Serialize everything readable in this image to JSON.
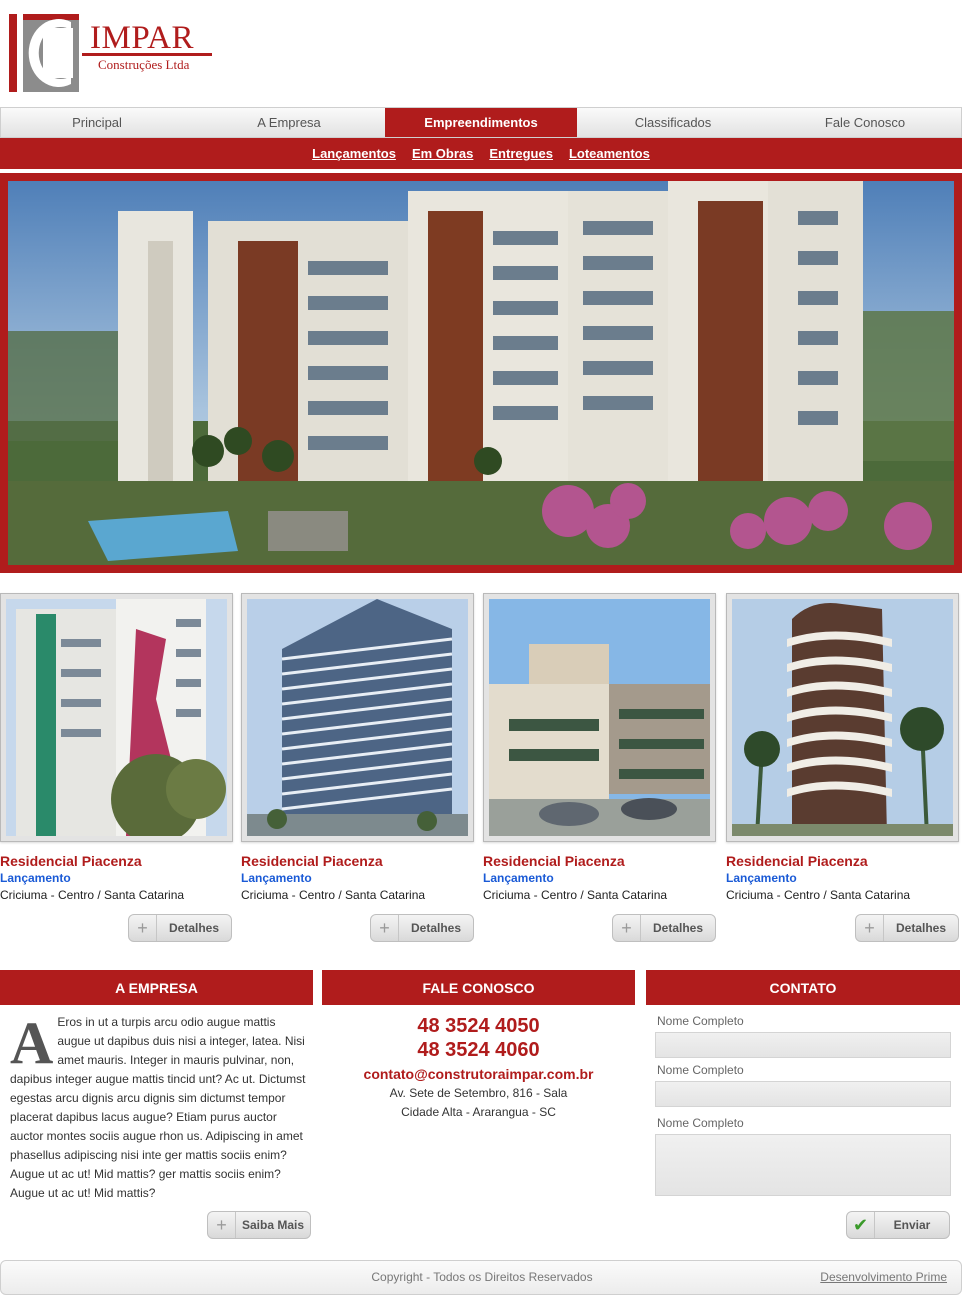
{
  "brand": {
    "name": "IMPAR",
    "subtitle": "Construções Ltda",
    "color": "#b01c1c"
  },
  "nav": {
    "items": [
      {
        "label": "Principal"
      },
      {
        "label": "A Empresa"
      },
      {
        "label": "Empreendimentos",
        "active": true
      },
      {
        "label": "Classificados"
      },
      {
        "label": "Fale Conosco"
      }
    ],
    "subitems": [
      {
        "label": "Lançamentos"
      },
      {
        "label": "Em Obras"
      },
      {
        "label": "Entregues"
      },
      {
        "label": "Loteamentos"
      }
    ]
  },
  "projects": [
    {
      "title": "Residencial Piacenza",
      "status": "Lançamento",
      "location": "Criciuma - Centro / Santa Catarina",
      "button": "Detalhes"
    },
    {
      "title": "Residencial Piacenza",
      "status": "Lançamento",
      "location": "Criciuma - Centro / Santa Catarina",
      "button": "Detalhes"
    },
    {
      "title": "Residencial Piacenza",
      "status": "Lançamento",
      "location": "Criciuma - Centro / Santa Catarina",
      "button": "Detalhes"
    },
    {
      "title": "Residencial Piacenza",
      "status": "Lançamento",
      "location": "Criciuma - Centro / Santa Catarina",
      "button": "Detalhes"
    }
  ],
  "about": {
    "heading": "A EMPRESA",
    "dropcap": "A",
    "text": "Eros in ut a turpis arcu odio augue mattis augue ut dapibus duis nisi a integer, latea. Nisi amet mauris. Integer in mauris pulvinar, non, dapibus integer augue mattis tincid unt? Ac ut. Dictumst egestas arcu dignis arcu dignis sim dictumst tempor placerat dapibus lacus augue? Etiam purus auctor auctor montes sociis augue rhon us. Adipiscing in amet phasellus adipiscing nisi inte ger mattis sociis enim? Augue ut ac ut! Mid mattis? ger mattis sociis enim? Augue ut ac ut! Mid mattis?",
    "button": "Saiba Mais"
  },
  "fale": {
    "heading": "FALE CONOSCO",
    "phone1": "48 3524 4050",
    "phone2": "48 3524 4060",
    "email": "contato@construtoraimpar.com.br",
    "address1": "Av. Sete de Setembro, 816 - Sala",
    "address2": "Cidade Alta - Ararangua - SC"
  },
  "contact_form": {
    "heading": "CONTATO",
    "label1": "Nome Completo",
    "label2": "Nome Completo",
    "label3": "Nome Completo",
    "button": "Enviar"
  },
  "footer": {
    "copyright": "Copyright - Todos os Direitos Reservados",
    "developer": "Desenvolvimento Prime"
  }
}
